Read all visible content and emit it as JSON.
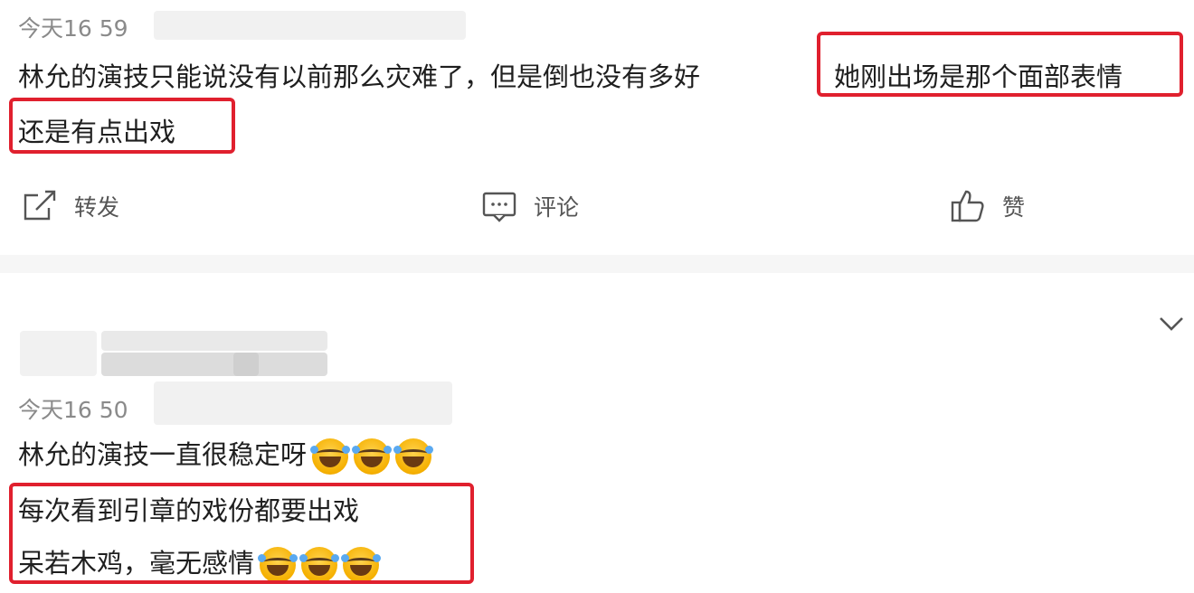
{
  "comment1": {
    "timestamp": "今天16 59",
    "line1": "林允的演技只能说没有以前那么灾难了，但是倒也没有多好",
    "highlight1": "她刚出场是那个面部表情",
    "line2": "还是有点出戏",
    "actions": {
      "repost": "转发",
      "comment": "评论",
      "like": "赞"
    }
  },
  "comment2": {
    "timestamp": "今天16 50",
    "line1": "林允的演技一直很稳定呀",
    "line2": "每次看到引章的戏份都要出戏",
    "line3": "呆若木鸡，毫无感情"
  },
  "colors": {
    "highlight_border": "#e0202e",
    "timestamp": "#8a8a8a",
    "text": "#1f1f1f",
    "divider": "#f6f6f6"
  },
  "icons": {
    "repost": "repost-icon",
    "comment": "comment-icon",
    "like": "thumbs-up-icon",
    "expand": "chevron-down-icon",
    "emoji": "laugh-cry-emoji"
  }
}
